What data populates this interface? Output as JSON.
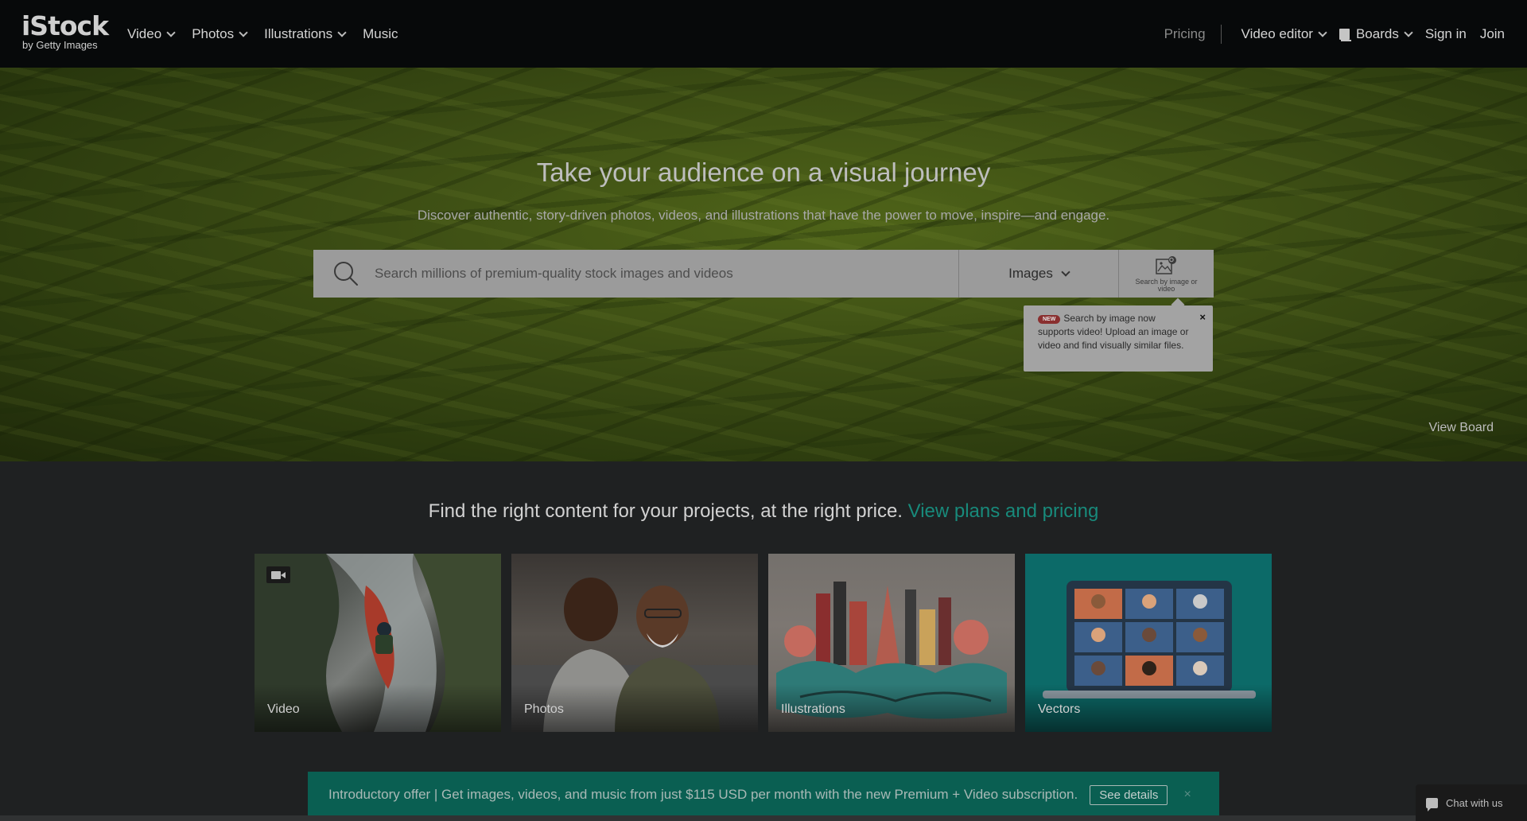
{
  "nav": {
    "logo_main": "iStock",
    "logo_sub": "by Getty Images",
    "left_items": [
      {
        "label": "Video"
      },
      {
        "label": "Photos"
      },
      {
        "label": "Illustrations"
      },
      {
        "label": "Music"
      }
    ],
    "pricing": "Pricing",
    "video_editor": "Video editor",
    "boards": "Boards",
    "sign_in": "Sign in",
    "join": "Join"
  },
  "hero": {
    "title": "Take your audience on a visual journey",
    "subtitle": "Discover authentic, story-driven photos, videos, and illustrations that have the power to move, inspire—and engage.",
    "search_placeholder": "Search millions of premium-quality stock images and videos",
    "media_type": "Images",
    "image_search_label": "Search by image or video",
    "tooltip_badge": "NEW",
    "tooltip_text": "Search by image now supports video! Upload an image or video and find visually similar files.",
    "tooltip_close": "×",
    "view_board": "View Board"
  },
  "main": {
    "promo_text": "Find the right content for your projects, at the right price.",
    "promo_link": "View plans and pricing",
    "cards": [
      {
        "label": "Video"
      },
      {
        "label": "Photos"
      },
      {
        "label": "Illustrations"
      },
      {
        "label": "Vectors"
      }
    ]
  },
  "banner": {
    "text": "Introductory offer | Get images, videos, and music from just $115 USD per month with the new Premium + Video subscription.",
    "button": "See details",
    "close": "×"
  },
  "chat": {
    "label": "Chat with us"
  },
  "colors": {
    "nav_bg": "#07090a",
    "accent_teal": "#188a7b",
    "banner_bg": "#0a5f52",
    "vectors_bg": "#0c6a68"
  }
}
